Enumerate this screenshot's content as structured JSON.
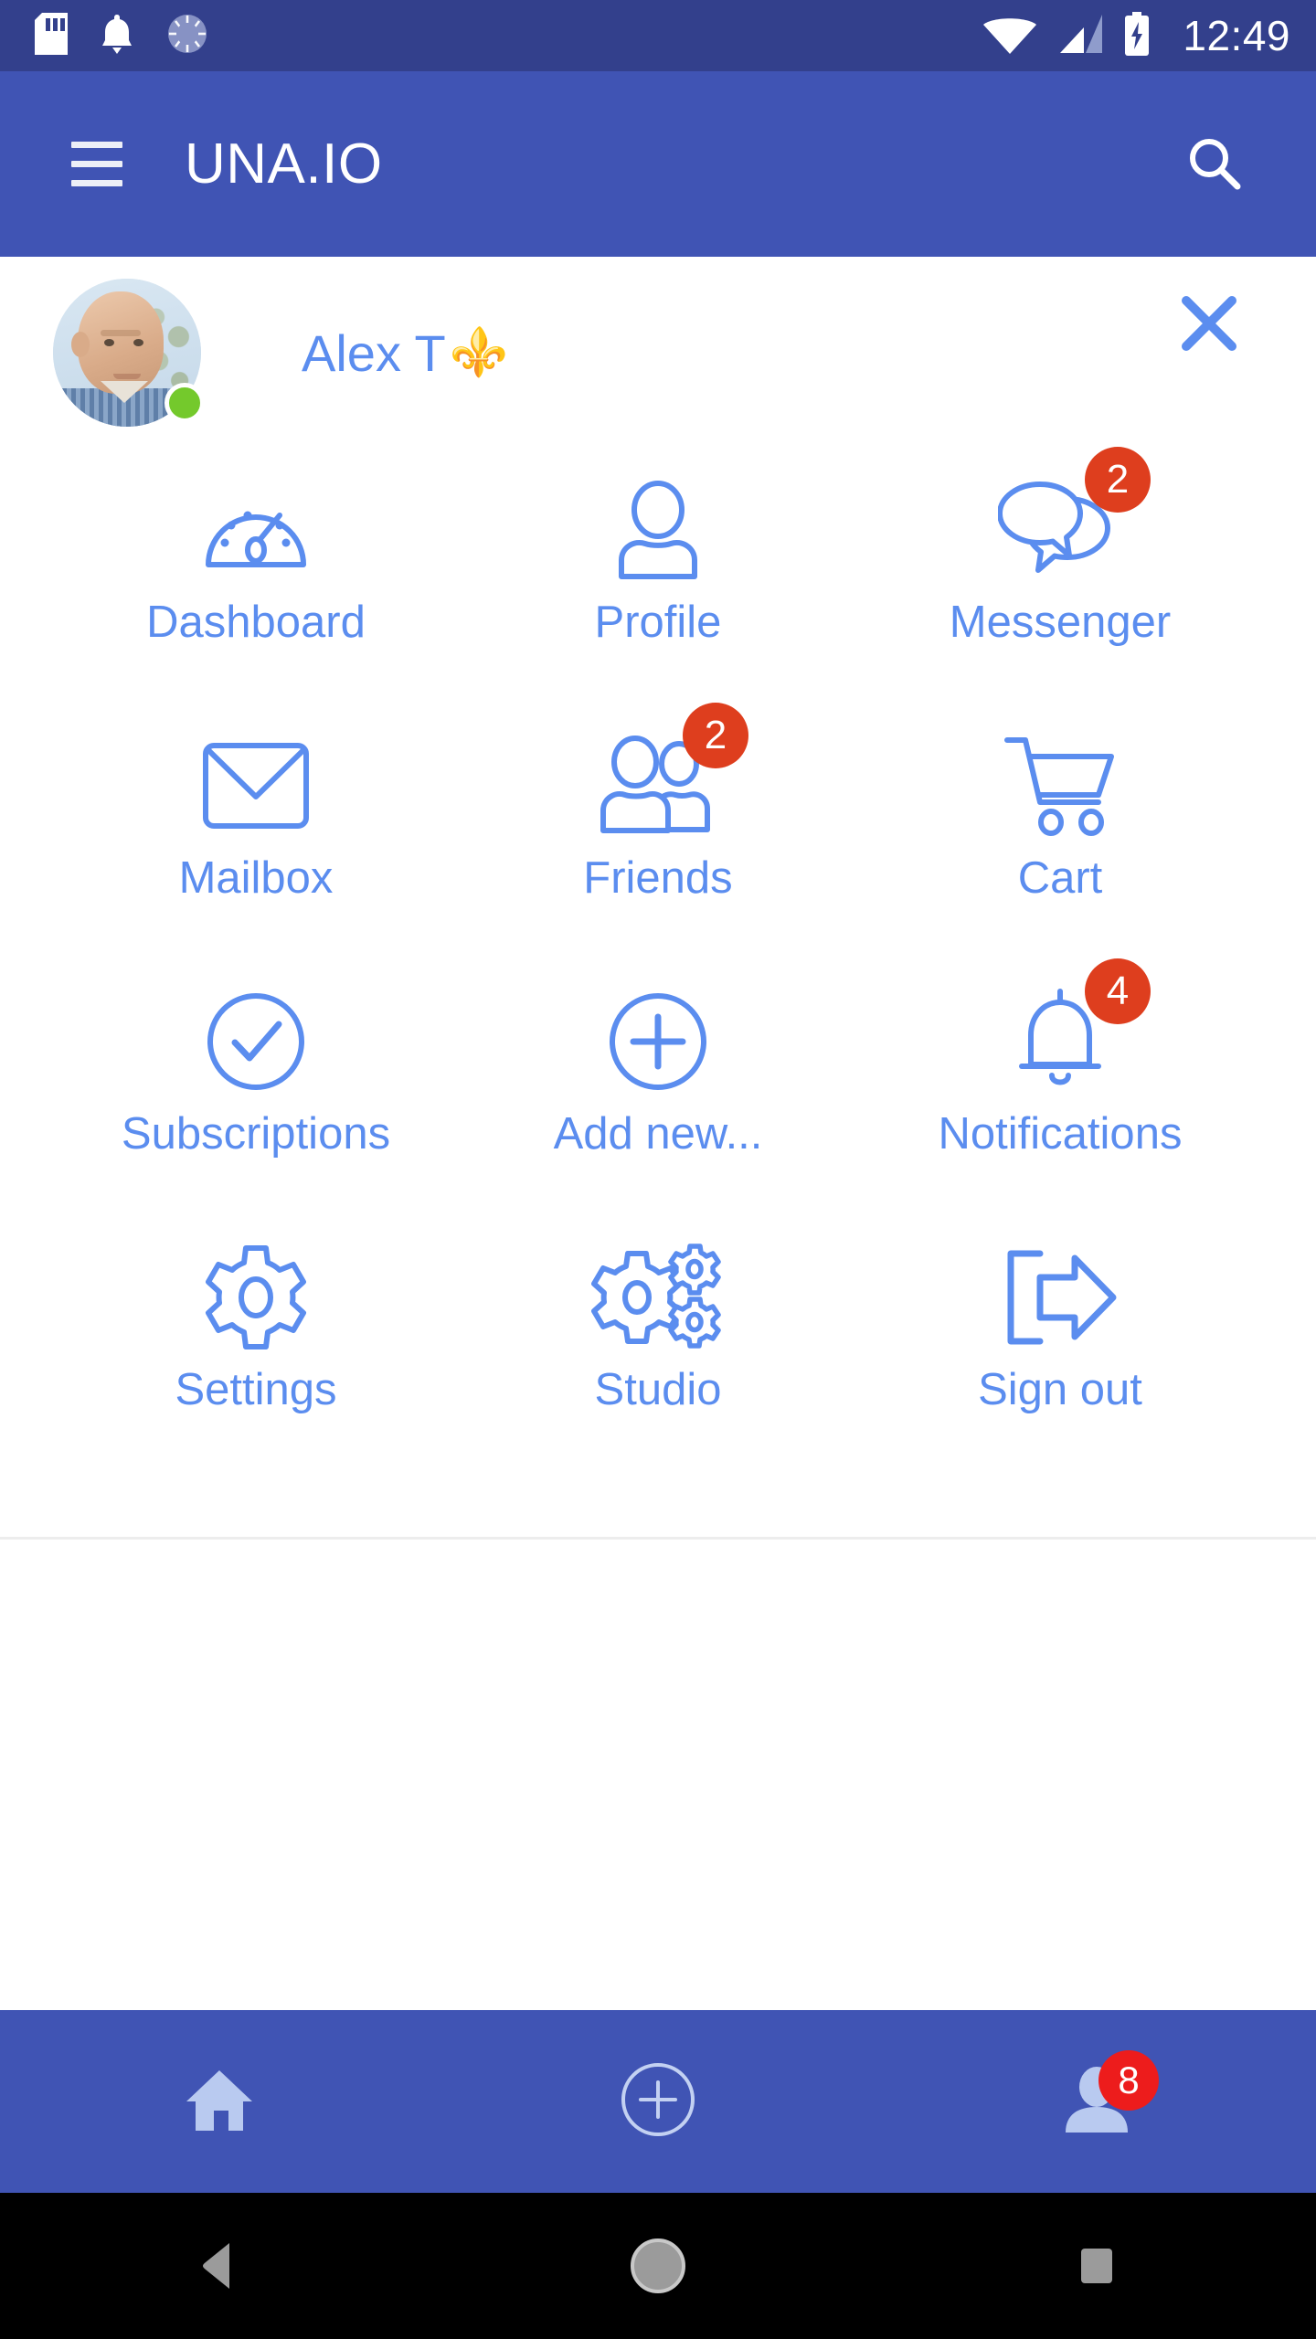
{
  "status_bar": {
    "time": "12:49",
    "left_icons": [
      "sd-card-icon",
      "bell-icon",
      "sync-spinner-icon"
    ],
    "right_icons": [
      "wifi-icon",
      "cellular-signal-icon",
      "battery-charging-icon"
    ],
    "background_color": "#33408c"
  },
  "app_bar": {
    "menu_icon": "hamburger-menu-icon",
    "title": "UNA.IO",
    "search_icon": "search-icon",
    "background_color": "#4054b4"
  },
  "panel": {
    "close_icon": "close-icon",
    "profile": {
      "name": "Alex T",
      "badge_emoji": "⚜️",
      "online_status": "online",
      "online_color": "#74c92c",
      "avatar_alt": "user-avatar"
    },
    "accent_color": "#5b8def",
    "badge_color": "#de3e1e",
    "items": [
      {
        "label": "Dashboard",
        "icon": "dashboard-gauge-icon",
        "badge": null
      },
      {
        "label": "Profile",
        "icon": "person-icon",
        "badge": null
      },
      {
        "label": "Messenger",
        "icon": "chat-bubbles-icon",
        "badge": "2"
      },
      {
        "label": "Mailbox",
        "icon": "envelope-icon",
        "badge": null
      },
      {
        "label": "Friends",
        "icon": "two-people-icon",
        "badge": "2"
      },
      {
        "label": "Cart",
        "icon": "shopping-cart-icon",
        "badge": null
      },
      {
        "label": "Subscriptions",
        "icon": "check-circle-icon",
        "badge": null
      },
      {
        "label": "Add new...",
        "icon": "plus-circle-icon",
        "badge": null
      },
      {
        "label": "Notifications",
        "icon": "bell-icon",
        "badge": "4"
      },
      {
        "label": "Settings",
        "icon": "gear-icon",
        "badge": null
      },
      {
        "label": "Studio",
        "icon": "multi-gear-icon",
        "badge": null
      },
      {
        "label": "Sign out",
        "icon": "sign-out-icon",
        "badge": null
      }
    ]
  },
  "bottom_nav": {
    "background_color": "#4054b4",
    "items": [
      {
        "icon": "home-icon",
        "badge": null
      },
      {
        "icon": "plus-circle-icon",
        "badge": null
      },
      {
        "icon": "person-icon",
        "badge": "8"
      }
    ],
    "badge_color": "#ed1c1c"
  },
  "android_nav": {
    "background_color": "#000000",
    "items": [
      {
        "icon": "back-triangle-icon"
      },
      {
        "icon": "home-circle-icon"
      },
      {
        "icon": "recents-square-icon"
      }
    ]
  }
}
